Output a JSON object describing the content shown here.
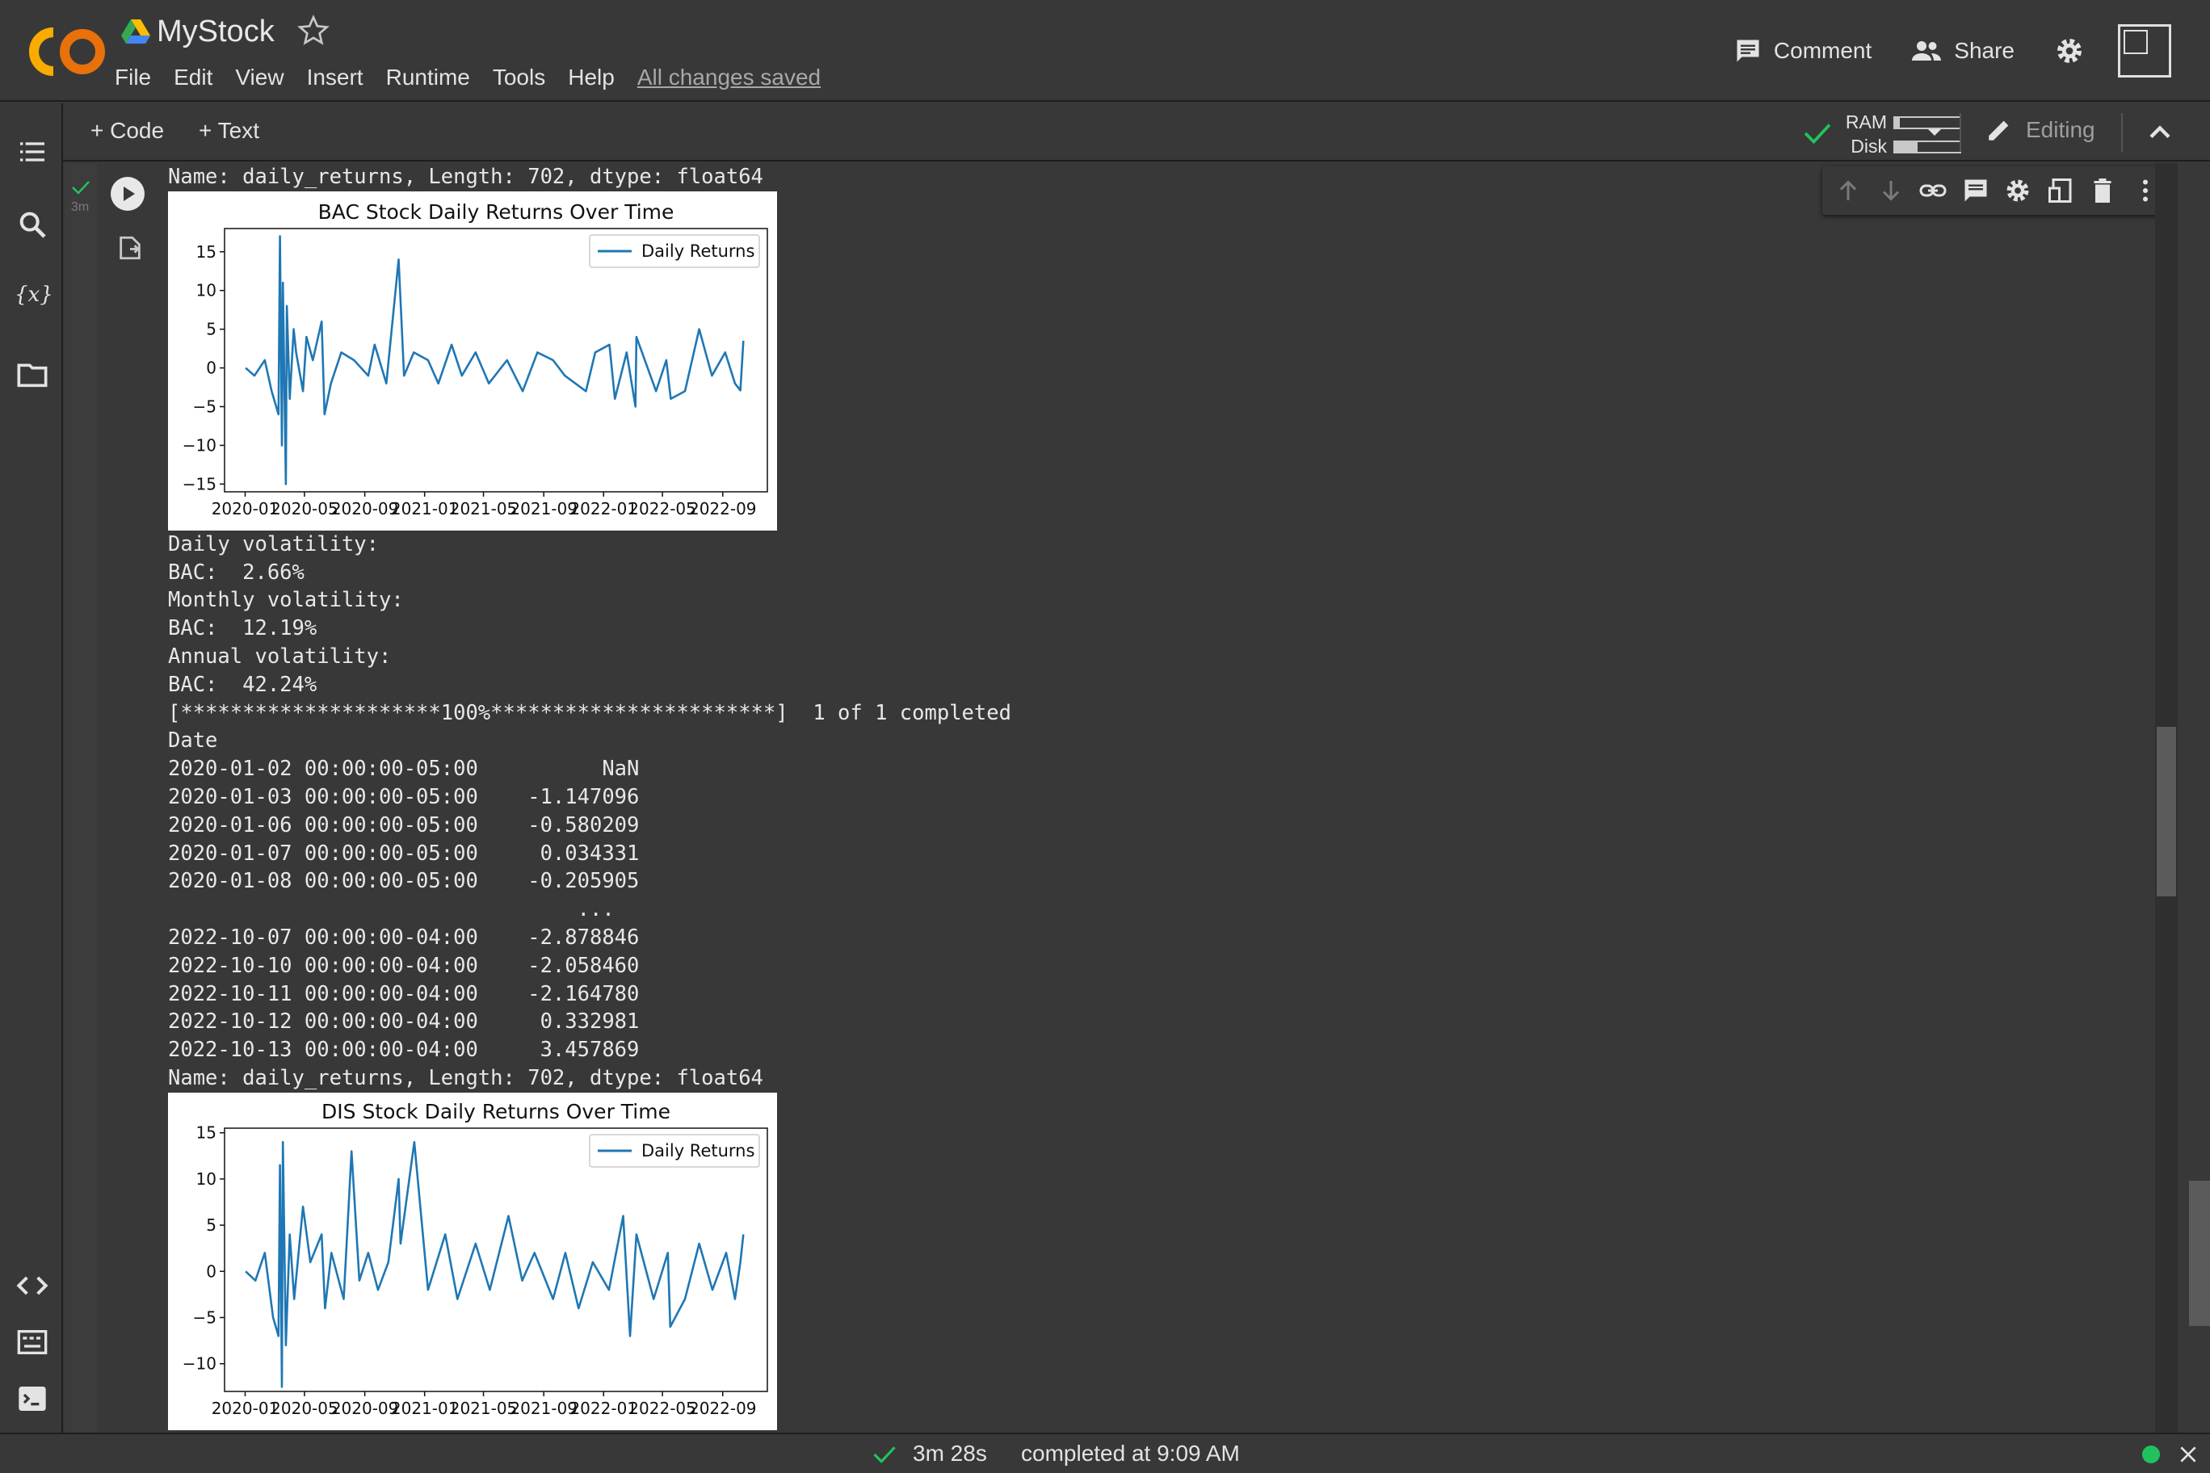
{
  "app": {
    "doc_title": "MyStock",
    "menu": [
      "File",
      "Edit",
      "View",
      "Insert",
      "Runtime",
      "Tools",
      "Help"
    ],
    "save_status": "All changes saved",
    "comment_label": "Comment",
    "share_label": "Share"
  },
  "toolbar": {
    "add_code": "+ Code",
    "add_text": "+ Text",
    "ram_label": "RAM",
    "disk_label": "Disk",
    "ram_usage": 0.08,
    "disk_usage": 0.35,
    "editing_label": "Editing"
  },
  "cell": {
    "exec_time_badge": "3m",
    "status_color": "#21c25e"
  },
  "output": {
    "line_name_1": "Name: daily_returns, Length: 702, dtype: float64",
    "vol_lines": [
      "Daily volatility:",
      "BAC:  2.66%",
      "Monthly volatility:",
      "BAC:  12.19%",
      "Annual volatility:",
      "BAC:  42.24%",
      "[*********************100%***********************]  1 of 1 completed",
      "Date",
      "2020-01-02 00:00:00-05:00          NaN",
      "2020-01-03 00:00:00-05:00    -1.147096",
      "2020-01-06 00:00:00-05:00    -0.580209",
      "2020-01-07 00:00:00-05:00     0.034331",
      "2020-01-08 00:00:00-05:00    -0.205905",
      "                                 ...   ",
      "2022-10-07 00:00:00-04:00    -2.878846",
      "2022-10-10 00:00:00-04:00    -2.058460",
      "2022-10-11 00:00:00-04:00    -2.164780",
      "2022-10-12 00:00:00-04:00     0.332981",
      "2022-10-13 00:00:00-04:00     3.457869",
      "Name: daily_returns, Length: 702, dtype: float64"
    ]
  },
  "chart_data": [
    {
      "type": "line",
      "title": "BAC Stock Daily Returns Over Time",
      "legend": "Daily Returns",
      "legend_position": "top-right",
      "x_ticks": [
        "2020-01",
        "2020-05",
        "2020-09",
        "2021-01",
        "2021-05",
        "2021-09",
        "2022-01",
        "2022-05",
        "2022-09"
      ],
      "y_ticks": [
        15,
        10,
        5,
        0,
        -5,
        -10,
        -15
      ],
      "ylim": [
        -16,
        18
      ],
      "series": [
        {
          "name": "Daily Returns",
          "color": "#1f77b4",
          "x": [
            "2020-01-02",
            "2020-01-20",
            "2020-02-10",
            "2020-02-24",
            "2020-03-09",
            "2020-03-12",
            "2020-03-16",
            "2020-03-18",
            "2020-03-24",
            "2020-03-26",
            "2020-04-01",
            "2020-04-09",
            "2020-04-14",
            "2020-04-28",
            "2020-05-05",
            "2020-05-18",
            "2020-06-05",
            "2020-06-11",
            "2020-06-24",
            "2020-07-15",
            "2020-08-10",
            "2020-09-08",
            "2020-09-21",
            "2020-10-15",
            "2020-11-09",
            "2020-11-20",
            "2020-12-10",
            "2021-01-08",
            "2021-01-29",
            "2021-02-25",
            "2021-03-18",
            "2021-04-15",
            "2021-05-12",
            "2021-06-18",
            "2021-07-20",
            "2021-08-19",
            "2021-09-20",
            "2021-10-14",
            "2021-11-26",
            "2021-12-15",
            "2022-01-13",
            "2022-01-24",
            "2022-02-17",
            "2022-03-07",
            "2022-03-09",
            "2022-04-18",
            "2022-05-09",
            "2022-05-18",
            "2022-06-16",
            "2022-07-15",
            "2022-08-10",
            "2022-09-06",
            "2022-09-26",
            "2022-10-07",
            "2022-10-13"
          ],
          "y": [
            0,
            -1,
            1,
            -3,
            -6,
            17,
            -10,
            11,
            -15,
            8,
            -4,
            5,
            2,
            -3,
            4,
            1,
            6,
            -6,
            -2,
            2,
            1,
            -1,
            3,
            -2,
            14,
            -1,
            2,
            1,
            -2,
            3,
            -1,
            2,
            -2,
            1,
            -3,
            2,
            1,
            -1,
            -3,
            2,
            3,
            -4,
            2,
            -5,
            4,
            -3,
            1,
            -4,
            -3,
            5,
            -1,
            2,
            -2,
            -2.9,
            3.5
          ]
        }
      ]
    },
    {
      "type": "line",
      "title": "DIS Stock Daily Returns Over Time",
      "legend": "Daily Returns",
      "legend_position": "top-right",
      "x_ticks": [
        "2020-01",
        "2020-05",
        "2020-09",
        "2021-01",
        "2021-05",
        "2021-09",
        "2022-01",
        "2022-05",
        "2022-09"
      ],
      "y_ticks": [
        15,
        10,
        5,
        0,
        -5,
        -10
      ],
      "ylim": [
        -13,
        15.5
      ],
      "series": [
        {
          "name": "Daily Returns",
          "color": "#1f77b4",
          "x": [
            "2020-01-02",
            "2020-01-22",
            "2020-02-10",
            "2020-02-27",
            "2020-03-09",
            "2020-03-12",
            "2020-03-16",
            "2020-03-18",
            "2020-03-24",
            "2020-04-01",
            "2020-04-10",
            "2020-04-28",
            "2020-05-13",
            "2020-06-05",
            "2020-06-12",
            "2020-06-25",
            "2020-07-20",
            "2020-08-05",
            "2020-08-21",
            "2020-09-08",
            "2020-09-28",
            "2020-10-19",
            "2020-11-09",
            "2020-11-13",
            "2020-12-11",
            "2021-01-08",
            "2021-02-12",
            "2021-03-09",
            "2021-04-15",
            "2021-05-14",
            "2021-06-21",
            "2021-07-19",
            "2021-08-13",
            "2021-09-20",
            "2021-10-15",
            "2021-11-11",
            "2021-12-10",
            "2022-01-12",
            "2022-02-10",
            "2022-02-24",
            "2022-03-09",
            "2022-04-13",
            "2022-05-12",
            "2022-05-17",
            "2022-06-16",
            "2022-07-15",
            "2022-08-11",
            "2022-09-08",
            "2022-09-26",
            "2022-10-07",
            "2022-10-13"
          ],
          "y": [
            0,
            -1,
            2,
            -5,
            -7,
            11.5,
            -12.5,
            14,
            -8,
            4,
            -3,
            7,
            1,
            4,
            -4,
            2,
            -3,
            13,
            -1,
            2,
            -2,
            1,
            10,
            3,
            14,
            -2,
            4,
            -3,
            3,
            -2,
            6,
            -1,
            2,
            -3,
            2,
            -4,
            1,
            -2,
            6,
            -7,
            4,
            -3,
            2,
            -6,
            -3,
            3,
            -2,
            2,
            -3,
            1,
            4
          ]
        }
      ]
    }
  ],
  "status": {
    "elapsed": "3m 28s",
    "completed": "completed at 9:09 AM"
  }
}
